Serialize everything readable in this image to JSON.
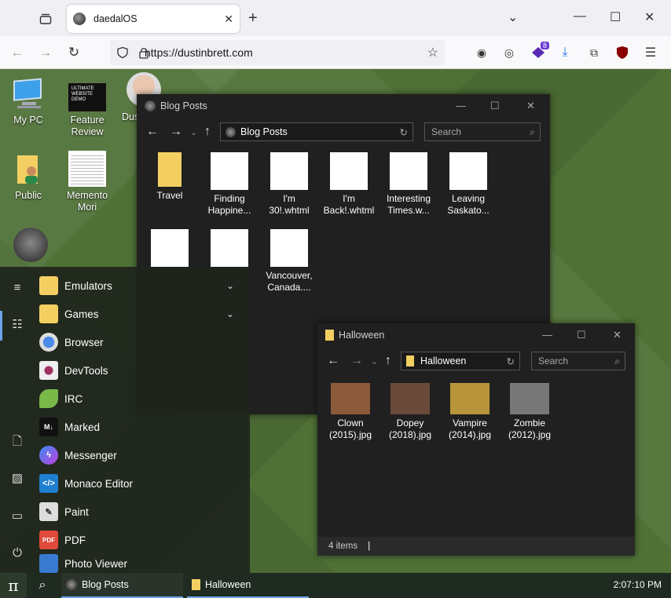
{
  "browser": {
    "tab_title": "daedalOS",
    "url": "https://dustinbrett.com",
    "extension_badge": "8"
  },
  "desktop": {
    "icons": [
      {
        "label": "My PC",
        "icon": "monitor-icon"
      },
      {
        "label": "Feature Review",
        "icon": "video-thumbnail-icon",
        "thumb_text": "ULTIMATE WEBSITE DEMO"
      },
      {
        "label": "Dus",
        "icon": "avatar-icon"
      },
      {
        "label": "Public",
        "icon": "user-folder-icon"
      },
      {
        "label": "Memento Mori",
        "icon": "document-icon"
      },
      {
        "label": "",
        "icon": "brain-icon"
      }
    ]
  },
  "blog_window": {
    "title": "Blog Posts",
    "address": "Blog Posts",
    "search_placeholder": "Search",
    "files": [
      {
        "label": "Travel",
        "type": "folder"
      },
      {
        "label": "Finding Happine...",
        "type": "doc"
      },
      {
        "label": "I'm 30!.whtml",
        "type": "doc"
      },
      {
        "label": "I'm Back!.whtml",
        "type": "doc"
      },
      {
        "label": "Interesting Times.w...",
        "type": "doc"
      },
      {
        "label": "Leaving Saskato...",
        "type": "doc"
      },
      {
        "label": "",
        "type": "doc"
      },
      {
        "label": "",
        "type": "doc"
      },
      {
        "label": "Vancouver, Canada....",
        "type": "doc"
      }
    ]
  },
  "halloween_window": {
    "title": "Halloween",
    "address": "Halloween",
    "search_placeholder": "Search",
    "status": "4 items",
    "files": [
      {
        "label": "Clown (2015).jpg",
        "color": "#8a5a3a"
      },
      {
        "label": "Dopey (2018).jpg",
        "color": "#6a4a3a"
      },
      {
        "label": "Vampire (2014).jpg",
        "color": "#b8953a"
      },
      {
        "label": "Zombie (2012).jpg",
        "color": "#777777"
      }
    ]
  },
  "start_menu": {
    "items": [
      {
        "label": "Emulators",
        "icon": "folder-icon",
        "expandable": true
      },
      {
        "label": "Games",
        "icon": "folder-icon",
        "expandable": true
      },
      {
        "label": "Browser",
        "icon": "browser-icon"
      },
      {
        "label": "DevTools",
        "icon": "devtools-icon"
      },
      {
        "label": "IRC",
        "icon": "irc-icon"
      },
      {
        "label": "Marked",
        "icon": "marked-icon"
      },
      {
        "label": "Messenger",
        "icon": "messenger-icon"
      },
      {
        "label": "Monaco Editor",
        "icon": "vscode-icon"
      },
      {
        "label": "Paint",
        "icon": "paint-icon"
      },
      {
        "label": "PDF",
        "icon": "pdf-icon"
      },
      {
        "label": "Photo Viewer",
        "icon": "photo-icon"
      }
    ]
  },
  "taskbar": {
    "start_glyph": "π",
    "entries": [
      "Blog Posts",
      "Halloween"
    ],
    "clock": "2:07:10 PM"
  },
  "colors": {
    "desktop": "#4f7136",
    "window_bg": "#202020",
    "taskbar_accent": "#6aa6e8"
  }
}
